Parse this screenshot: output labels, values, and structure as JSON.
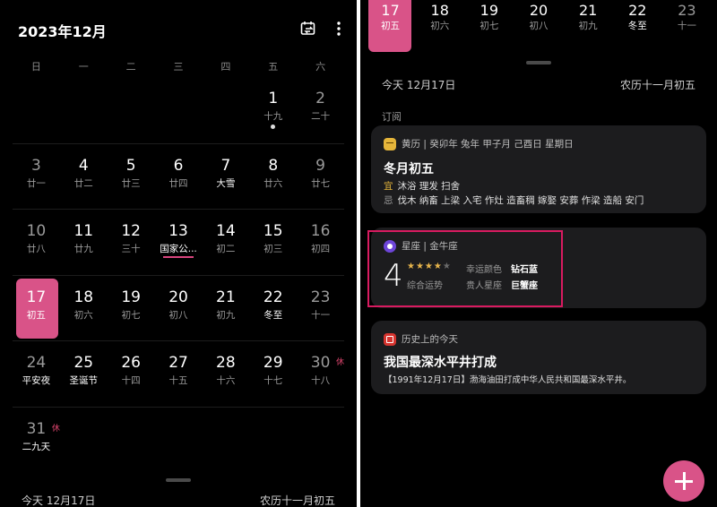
{
  "left": {
    "month_title": "2023年12月",
    "weekdays": [
      "日",
      "一",
      "二",
      "三",
      "四",
      "五",
      "六"
    ],
    "weeks": [
      [
        null,
        null,
        null,
        null,
        null,
        {
          "d": "1",
          "l": "十九",
          "dot": true
        },
        {
          "d": "2",
          "l": "二十"
        }
      ],
      [
        {
          "d": "3",
          "l": "廿一"
        },
        {
          "d": "4",
          "l": "廿二"
        },
        {
          "d": "5",
          "l": "廿三"
        },
        {
          "d": "6",
          "l": "廿四"
        },
        {
          "d": "7",
          "l": "大雪",
          "term": true
        },
        {
          "d": "8",
          "l": "廿六"
        },
        {
          "d": "9",
          "l": "廿七"
        }
      ],
      [
        {
          "d": "10",
          "l": "廿八"
        },
        {
          "d": "11",
          "l": "廿九"
        },
        {
          "d": "12",
          "l": "三十"
        },
        {
          "d": "13",
          "l": "国家公...",
          "hol": true,
          "ul": true
        },
        {
          "d": "14",
          "l": "初二"
        },
        {
          "d": "15",
          "l": "初三"
        },
        {
          "d": "16",
          "l": "初四"
        }
      ],
      [
        {
          "d": "17",
          "l": "初五",
          "today": true
        },
        {
          "d": "18",
          "l": "初六"
        },
        {
          "d": "19",
          "l": "初七"
        },
        {
          "d": "20",
          "l": "初八"
        },
        {
          "d": "21",
          "l": "初九"
        },
        {
          "d": "22",
          "l": "冬至",
          "term": true
        },
        {
          "d": "23",
          "l": "十一"
        }
      ],
      [
        {
          "d": "24",
          "l": "平安夜",
          "hol": true
        },
        {
          "d": "25",
          "l": "圣诞节",
          "hol": true
        },
        {
          "d": "26",
          "l": "十四"
        },
        {
          "d": "27",
          "l": "十五"
        },
        {
          "d": "28",
          "l": "十六"
        },
        {
          "d": "29",
          "l": "十七"
        },
        {
          "d": "30",
          "l": "十八",
          "rest": "休"
        }
      ],
      [
        {
          "d": "31",
          "l": "二九天",
          "hol": true,
          "rest": "休"
        },
        null,
        null,
        null,
        null,
        null,
        null
      ]
    ],
    "footer_today": "今天  12月17日",
    "footer_lunar": "农历十一月初五"
  },
  "right": {
    "strip": [
      {
        "d": "17",
        "l": "初五",
        "today": true
      },
      {
        "d": "18",
        "l": "初六"
      },
      {
        "d": "19",
        "l": "初七"
      },
      {
        "d": "20",
        "l": "初八"
      },
      {
        "d": "21",
        "l": "初九"
      },
      {
        "d": "22",
        "l": "冬至",
        "term": true
      },
      {
        "d": "23",
        "l": "十一"
      }
    ],
    "day_today": "今天  12月17日",
    "day_lunar": "农历十一月初五",
    "section_label": "订阅",
    "almanac": {
      "head": "黄历 | 癸卯年 兔年 甲子月 己酉日 星期日",
      "title": "冬月初五",
      "yi_tag": "宜",
      "yi": "沐浴 理发 扫舍",
      "ji_tag": "忌",
      "ji": "伐木 纳畜 上梁 入宅 作灶 造畜稠 嫁娶 安葬 作梁 造船 安门"
    },
    "astro": {
      "head": "星座 | 金牛座",
      "score": "4",
      "stars_on": "★★★★",
      "stars_off": "★",
      "score_label": "综合运势",
      "lucky_color_label": "幸运颜色",
      "lucky_color": "钻石蓝",
      "lucky_sign_label": "贵人星座",
      "lucky_sign": "巨蟹座"
    },
    "history": {
      "head": "历史上的今天",
      "title": "我国最深水平井打成",
      "desc": "【1991年12月17日】渤海油田打成中华人民共和国最深水平井。"
    }
  },
  "colors": {
    "accent": "#d95388",
    "highlight_box": "#d81b60",
    "background": "#000000",
    "card": "#1c1c1e"
  }
}
